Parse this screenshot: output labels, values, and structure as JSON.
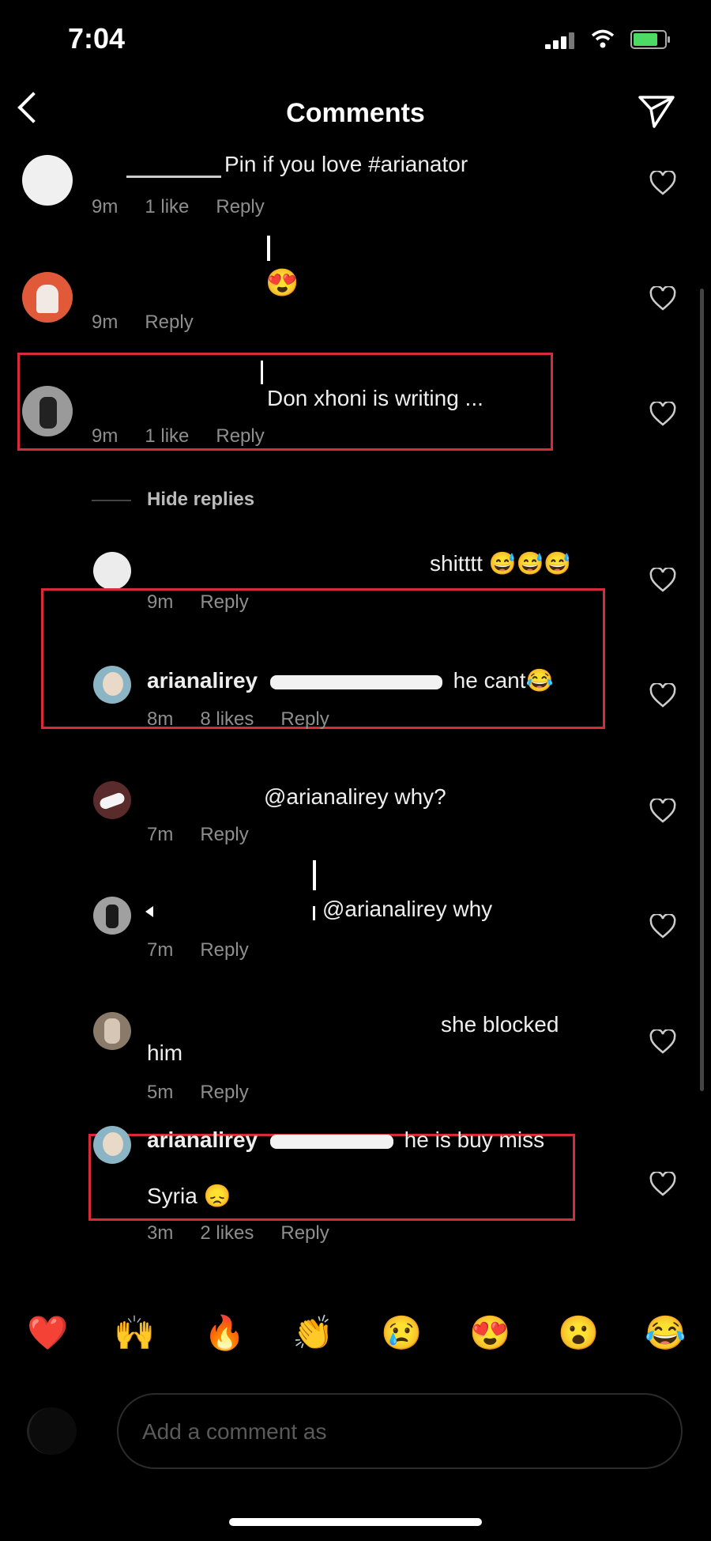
{
  "status": {
    "time": "7:04"
  },
  "header": {
    "title": "Comments"
  },
  "comments": [
    {
      "text": "Pin if you love #arianator",
      "time": "9m",
      "likes": "1 like",
      "reply": "Reply"
    },
    {
      "text": "😍",
      "time": "9m",
      "reply": "Reply"
    },
    {
      "text": "Don xhoni is writing ...",
      "time": "9m",
      "likes": "1 like",
      "reply": "Reply"
    }
  ],
  "hide_replies": "Hide replies",
  "replies": [
    {
      "text": "shitttt 😅😅😅",
      "time": "9m",
      "reply": "Reply"
    },
    {
      "username": "arianalirey",
      "text": "he cant😂",
      "time": "8m",
      "likes": "8 likes",
      "reply": "Reply"
    },
    {
      "text": "@arianalirey why?",
      "time": "7m",
      "reply": "Reply"
    },
    {
      "text": "@arianalirey why",
      "time": "7m",
      "reply": "Reply"
    },
    {
      "text": "she blocked",
      "text2": "him",
      "time": "5m",
      "reply": "Reply"
    },
    {
      "username": "arianalirey",
      "text": "he is buy miss",
      "text2": "Syria 😞",
      "time": "3m",
      "likes": "2 likes",
      "reply": "Reply"
    }
  ],
  "reactions": [
    "❤️",
    "🙌",
    "🔥",
    "👏",
    "😢",
    "😍",
    "😮",
    "😂"
  ],
  "input": {
    "placeholder": "Add a comment as"
  },
  "colors": {
    "background": "#000000",
    "highlight": "#d72b3a",
    "muted": "#8e8e8e"
  }
}
